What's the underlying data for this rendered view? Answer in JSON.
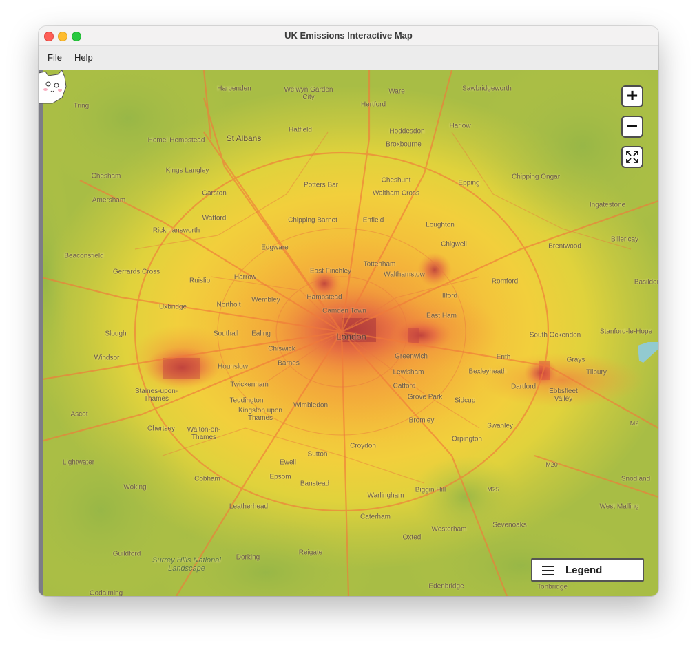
{
  "window": {
    "title": "UK Emissions Interactive Map"
  },
  "menubar": {
    "items": [
      "File",
      "Help"
    ]
  },
  "controls": {
    "zoom_in_label": "+",
    "zoom_out_label": "−",
    "fullscreen_icon": "expand-icon",
    "legend_label": "Legend",
    "legend_icon": "hamburger-icon"
  },
  "map": {
    "places": [
      "Harpenden",
      "Welwyn Garden City",
      "Ware",
      "Sawbridgeworth",
      "Tring",
      "Hertford",
      "Hatfield",
      "Hoddesdon",
      "Harlow",
      "St Albans",
      "Hemel Hempstead",
      "Broxbourne",
      "Chesham",
      "Kings Langley",
      "Cheshunt",
      "Epping",
      "Chipping Ongar",
      "Amersham",
      "Potters Bar",
      "Waltham Cross",
      "Garston",
      "Watford",
      "Ingatestone",
      "Chipping Barnet",
      "Enfield",
      "Loughton",
      "Rickmansworth",
      "Edgware",
      "Chigwell",
      "Brentwood",
      "Billericay",
      "Beaconsfield",
      "Tottenham",
      "East Finchley",
      "Walthamstow",
      "Romford",
      "Gerrards Cross",
      "Ruislip",
      "Harrow",
      "Hampstead",
      "Ilford",
      "Basildon",
      "Uxbridge",
      "Northolt",
      "Wembley",
      "Camden Town",
      "East Ham",
      "Stanford-le-Hope",
      "Slough",
      "Southall",
      "Ealing",
      "London",
      "South Ockendon",
      "Windsor",
      "Chiswick",
      "Barnes",
      "Greenwich",
      "Erith",
      "Grays",
      "Hounslow",
      "Tilbury",
      "Lewisham",
      "Bexleyheath",
      "Dartford",
      "Ebbsfleet Valley",
      "Staines-upon-Thames",
      "Twickenham",
      "Catford",
      "Teddington",
      "Grove Park",
      "Sidcup",
      "Kingston upon Thames",
      "Wimbledon",
      "Ascot",
      "Bromley",
      "Swanley",
      "Chertsey",
      "Walton-on-Thames",
      "Orpington",
      "Croydon",
      "Sutton",
      "Lightwater",
      "Ewell",
      "Epsom",
      "Cobham",
      "Banstead",
      "Woking",
      "Biggin Hill",
      "Snodland",
      "Warlingham",
      "Leatherhead",
      "West Malling",
      "Caterham",
      "Sevenoaks",
      "Westerham",
      "Oxted",
      "Guildford",
      "Reigate",
      "Dorking",
      "Surrey Hills National Landscape",
      "Edenbridge",
      "Tonbridge",
      "Slough",
      "Chesham",
      "Godalming",
      "M2",
      "M20",
      "M25"
    ]
  },
  "colors": {
    "low_emission": "#9fbb47",
    "mid_emission": "#f2d23c",
    "high_emission": "#f28b3a",
    "peak_emission": "#c0403e"
  }
}
